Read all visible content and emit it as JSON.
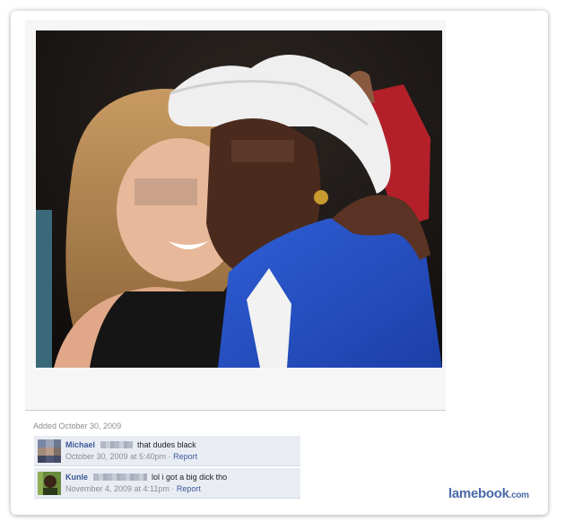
{
  "photo": {
    "added_label": "Added October 30, 2009"
  },
  "comments": [
    {
      "name": "Michael",
      "text": "that dudes black",
      "timestamp": "October 30, 2009 at 5:40pm",
      "separator": " · ",
      "report_label": "Report"
    },
    {
      "name": "Kunle",
      "text": "lol i got a big dick tho",
      "timestamp": "November 4, 2009 at 4:11pm",
      "separator": " · ",
      "report_label": "Report"
    }
  ],
  "watermark": {
    "main": "lamebook",
    "tld": ".com"
  },
  "colors": {
    "link": "#3b5998",
    "comment_bg": "#e9ecf3",
    "muted": "#8c8c8c"
  }
}
